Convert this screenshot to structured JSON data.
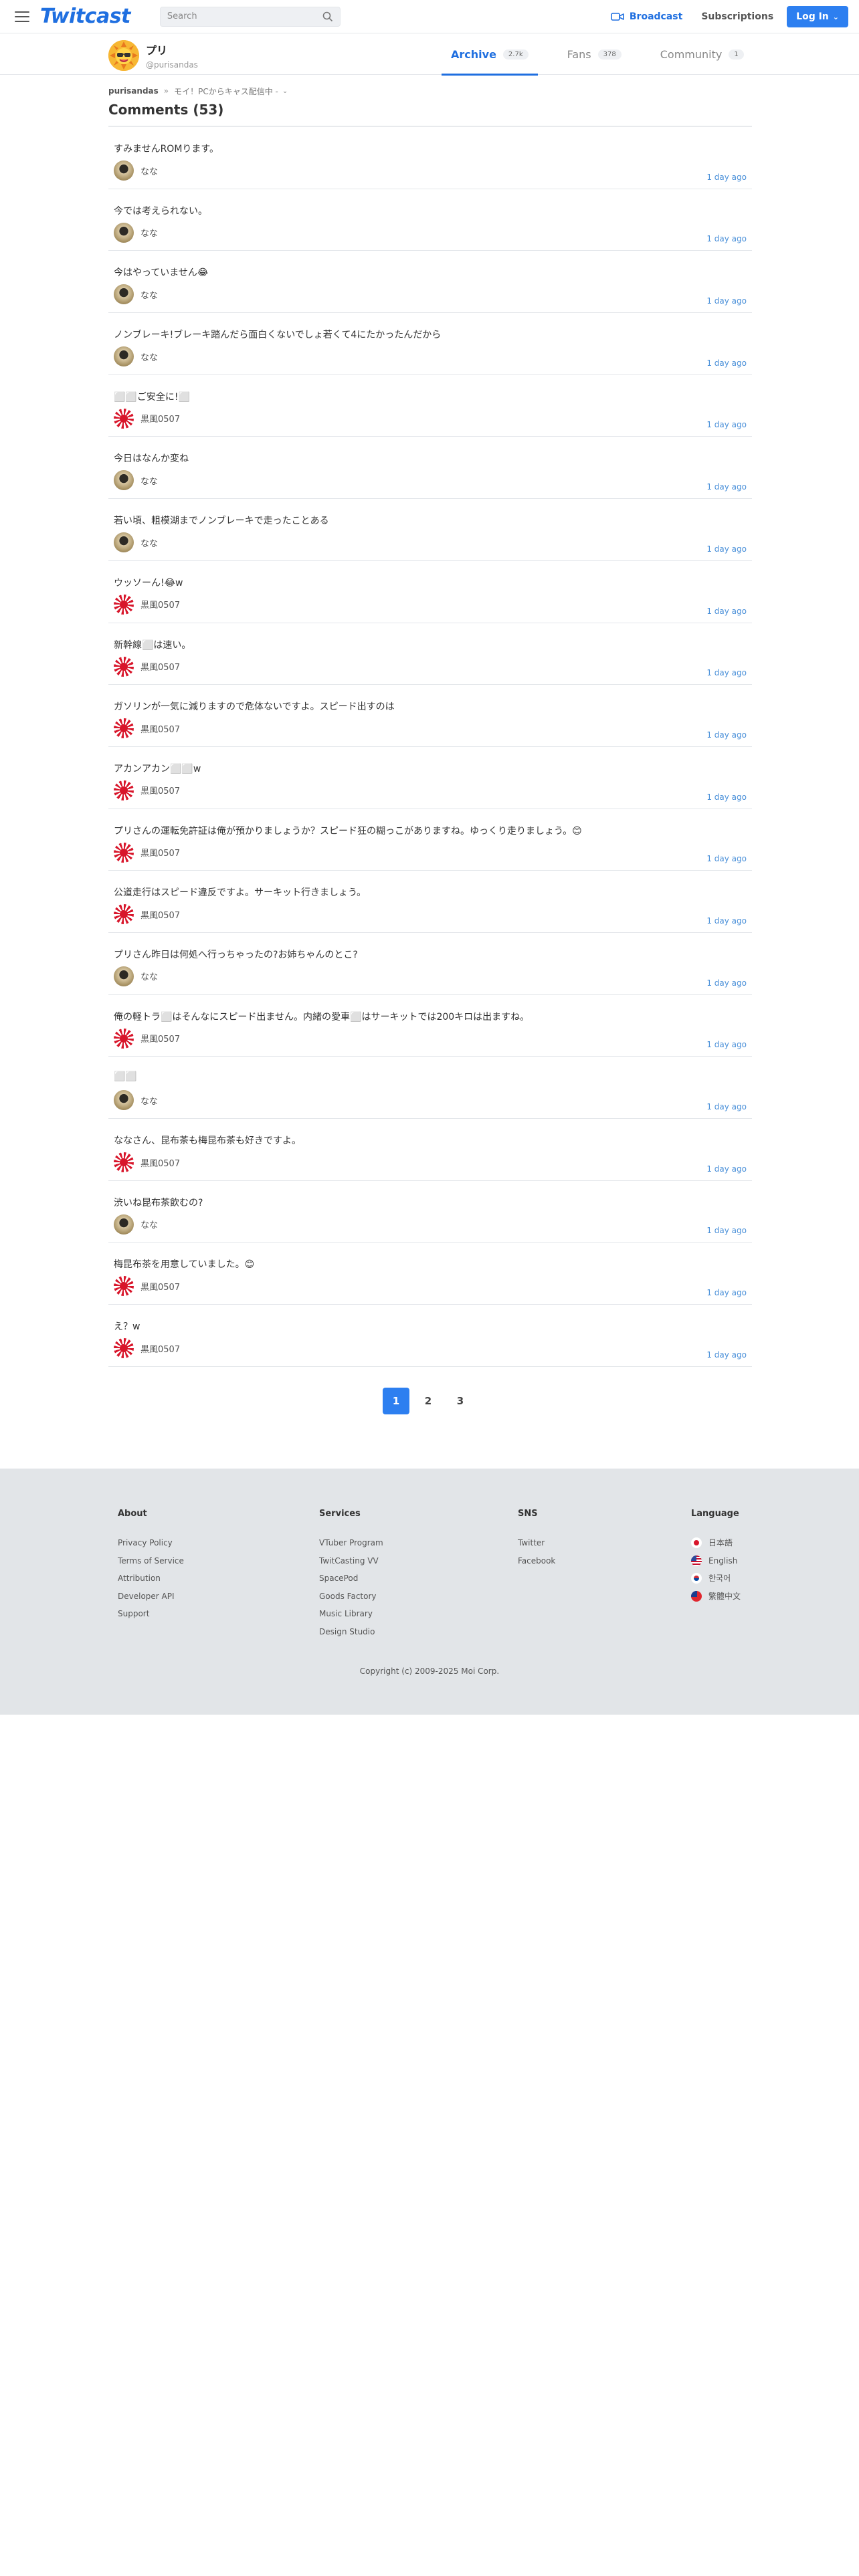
{
  "header": {
    "logo": "Twitcast",
    "search_placeholder": "Search",
    "broadcast": "Broadcast",
    "subscriptions": "Subscriptions",
    "login": "Log In"
  },
  "profile": {
    "name": "プリ",
    "handle": "@purisandas"
  },
  "tabs": [
    {
      "label": "Archive",
      "count": "2.7k"
    },
    {
      "label": "Fans",
      "count": "378"
    },
    {
      "label": "Community",
      "count": "1"
    }
  ],
  "breadcrumb": {
    "user": "purisandas",
    "sep": "»",
    "movie": "モイ！PCからキャス配信中 -"
  },
  "title": "Comments (53)",
  "comments": [
    {
      "text": "すみませんROMります。",
      "author": "なな",
      "avatar": "nana",
      "time": "1 day ago"
    },
    {
      "text": "今では考えられない。",
      "author": "なな",
      "avatar": "nana",
      "time": "1 day ago"
    },
    {
      "text": "今はやっていません😂",
      "author": "なな",
      "avatar": "nana",
      "time": "1 day ago"
    },
    {
      "text": "ノンブレーキ!ブレーキ踏んだら面白くないでしょ若くて4にたかったんだから",
      "author": "なな",
      "avatar": "nana",
      "time": "1 day ago"
    },
    {
      "text": "⬜⬜ご安全に!⬜",
      "author": "黒風0507",
      "avatar": "heihu",
      "time": "1 day ago"
    },
    {
      "text": "今日はなんか変ね",
      "author": "なな",
      "avatar": "nana",
      "time": "1 day ago"
    },
    {
      "text": "若い頃、粗模湖までノンブレーキで走ったことある",
      "author": "なな",
      "avatar": "nana",
      "time": "1 day ago"
    },
    {
      "text": "ウッソーん!😂w",
      "author": "黒風0507",
      "avatar": "heihu",
      "time": "1 day ago"
    },
    {
      "text": "新幹線⬜は速い。",
      "author": "黒風0507",
      "avatar": "heihu",
      "time": "1 day ago"
    },
    {
      "text": "ガソリンが一気に減りますので危体ないですよ。スピード出すのは",
      "author": "黒風0507",
      "avatar": "heihu",
      "time": "1 day ago"
    },
    {
      "text": "アカンアカン⬜⬜w",
      "author": "黒風0507",
      "avatar": "heihu",
      "time": "1 day ago"
    },
    {
      "text": "プリさんの運転免許証は俺が預かりましょうか？スピード狂の糊っこがありますね。ゆっくり走りましょう。😊",
      "author": "黒風0507",
      "avatar": "heihu",
      "time": "1 day ago"
    },
    {
      "text": "公道走行はスピード違反ですよ。サーキット行きましょう。",
      "author": "黒風0507",
      "avatar": "heihu",
      "time": "1 day ago"
    },
    {
      "text": "プリさん昨日は何処へ行っちゃったの?お姉ちゃんのとこ?",
      "author": "なな",
      "avatar": "nana",
      "time": "1 day ago"
    },
    {
      "text": "俺の軽トラ⬜はそんなにスピード出ません。内緒の愛車⬜はサーキットでは200キロは出ますね。",
      "author": "黒風0507",
      "avatar": "heihu",
      "time": "1 day ago"
    },
    {
      "text": "⬜⬜",
      "author": "なな",
      "avatar": "nana",
      "time": "1 day ago"
    },
    {
      "text": "ななさん、昆布茶も梅昆布茶も好きですよ。",
      "author": "黒風0507",
      "avatar": "heihu",
      "time": "1 day ago"
    },
    {
      "text": "渋いね昆布茶飲むの?",
      "author": "なな",
      "avatar": "nana",
      "time": "1 day ago"
    },
    {
      "text": "梅昆布茶を用意していました。😊",
      "author": "黒風0507",
      "avatar": "heihu",
      "time": "1 day ago"
    },
    {
      "text": "え？w",
      "author": "黒風0507",
      "avatar": "heihu",
      "time": "1 day ago"
    }
  ],
  "pagination": [
    "1",
    "2",
    "3"
  ],
  "footer": {
    "about": {
      "heading": "About",
      "links": [
        "Privacy Policy",
        "Terms of Service",
        "Attribution",
        "Developer API",
        "Support"
      ]
    },
    "services": {
      "heading": "Services",
      "links": [
        "VTuber Program",
        "TwitCasting VV",
        "SpacePod",
        "Goods Factory",
        "Music Library",
        "Design Studio"
      ]
    },
    "sns": {
      "heading": "SNS",
      "links": [
        "Twitter",
        "Facebook"
      ]
    },
    "language": {
      "heading": "Language",
      "links": [
        "日本語",
        "English",
        "한국어",
        "繁體中文"
      ]
    },
    "copyright": "Copyright (c) 2009-2025 Moi Corp."
  },
  "colors": {
    "accent": "#1f6fe0",
    "button": "#2d7ff0",
    "time_link": "#4a90d9",
    "footer_bg": "#e2e5e8"
  }
}
